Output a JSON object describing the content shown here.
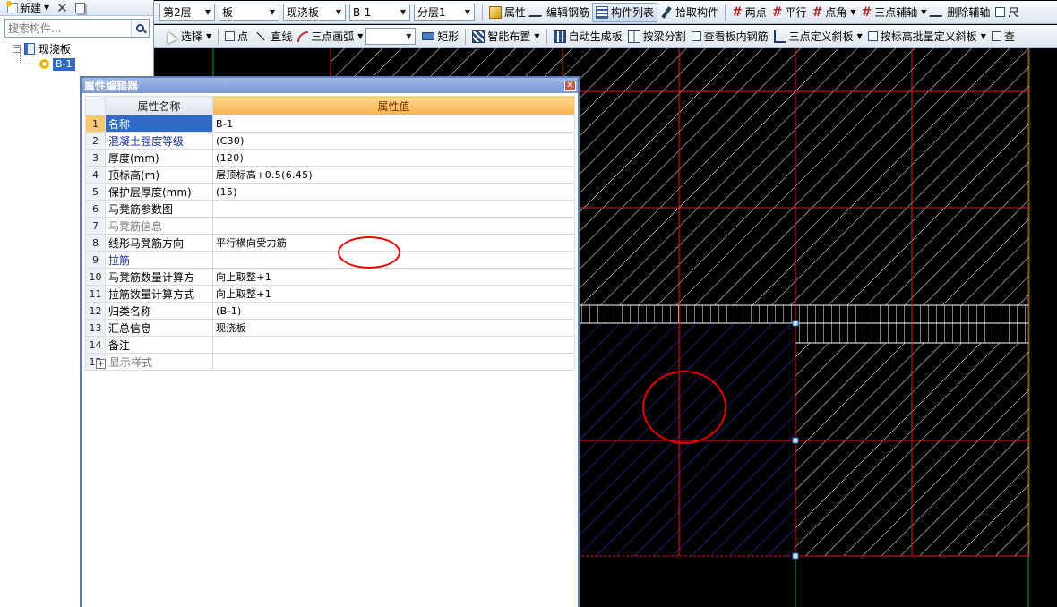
{
  "left_panel": {
    "new_label": "新建",
    "search_placeholder": "搜索构件...",
    "tree": {
      "root_label": "现浇板",
      "child_label": "B-1"
    }
  },
  "toolbar1": {
    "floor": "第2层",
    "category": "板",
    "type": "现浇板",
    "component": "B-1",
    "layer": "分层1",
    "buttons": [
      "属性",
      "编辑钢筋",
      "构件列表",
      "拾取构件",
      "两点",
      "平行",
      "点角",
      "三点辅轴",
      "删除辅轴",
      "尺"
    ]
  },
  "toolbar2": {
    "buttons": [
      "选择",
      "点",
      "直线",
      "三点画弧",
      "矩形",
      "智能布置",
      "自动生成板",
      "按梁分割",
      "查看板内钢筋",
      "三点定义斜板",
      "按标高批量定义斜板",
      "查"
    ]
  },
  "dialog": {
    "title": "属性编辑器",
    "col_name": "属性名称",
    "col_value": "属性值",
    "rows": [
      {
        "idx": "1",
        "name": "名称",
        "value": "B-1"
      },
      {
        "idx": "2",
        "name": "混凝土强度等级",
        "value": "(C30)"
      },
      {
        "idx": "3",
        "name": "厚度(mm)",
        "value": "(120)"
      },
      {
        "idx": "4",
        "name": "顶标高(m)",
        "value": "层顶标高+0.5(6.45)"
      },
      {
        "idx": "5",
        "name": "保护层厚度(mm)",
        "value": "(15)"
      },
      {
        "idx": "6",
        "name": "马凳筋参数图",
        "value": ""
      },
      {
        "idx": "7",
        "name": "马凳筋信息",
        "value": ""
      },
      {
        "idx": "8",
        "name": "线形马凳筋方向",
        "value": "平行横向受力筋"
      },
      {
        "idx": "9",
        "name": "拉筋",
        "value": ""
      },
      {
        "idx": "10",
        "name": "马凳筋数量计算方",
        "value": "向上取整+1"
      },
      {
        "idx": "11",
        "name": "拉筋数量计算方式",
        "value": "向上取整+1"
      },
      {
        "idx": "12",
        "name": "归类名称",
        "value": "(B-1)"
      },
      {
        "idx": "13",
        "name": "汇总信息",
        "value": "现浇板"
      },
      {
        "idx": "14",
        "name": "备注",
        "value": ""
      },
      {
        "idx": "15",
        "name": "显示样式",
        "value": ""
      }
    ]
  },
  "colors": {
    "grid_red": "#e01818",
    "axis_green": "#1f9a3a",
    "selected_slab_blue": "#2828c8",
    "highlight_blue": "#316ac5"
  }
}
